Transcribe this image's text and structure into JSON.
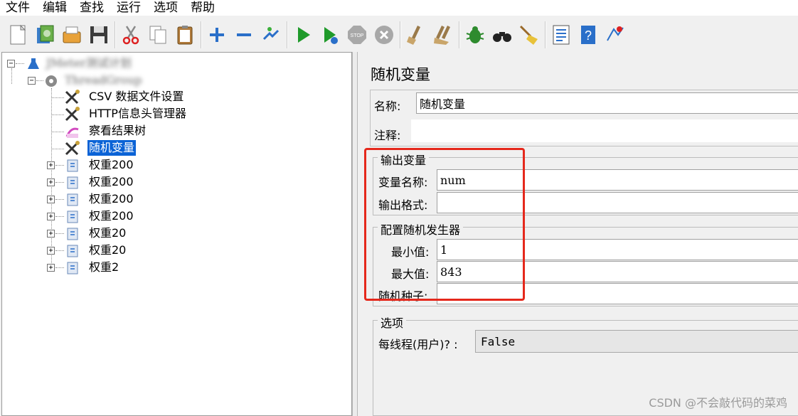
{
  "menu": [
    "文件",
    "编辑",
    "查找",
    "运行",
    "选项",
    "帮助"
  ],
  "toolbar": {
    "buttons": [
      "new-icon",
      "templates-icon",
      "open-icon",
      "save-icon",
      "cut-icon",
      "copy-icon",
      "paste-icon",
      "expand-icon",
      "collapse-icon",
      "toggle-icon",
      "start-icon",
      "start-no-pause-icon",
      "stop-icon",
      "shutdown-icon",
      "clear-icon",
      "clear-all-icon",
      "search-icon",
      "binoculars-icon",
      "broom-icon",
      "function-helper-icon",
      "help-icon",
      "remote-icon"
    ]
  },
  "tree": {
    "root_label": "JMeter测试计划",
    "thread_group_label": "ThreadGroup",
    "items": [
      {
        "label": "CSV 数据文件设置",
        "icon": "config-wrench-icon"
      },
      {
        "label": "HTTP信息头管理器",
        "icon": "config-wrench-icon"
      },
      {
        "label": "察看结果树",
        "icon": "listener-icon"
      },
      {
        "label": "随机变量",
        "icon": "config-wrench-icon",
        "selected": true
      },
      {
        "label": "权重200",
        "icon": "controller-icon"
      },
      {
        "label": "权重200",
        "icon": "controller-icon"
      },
      {
        "label": "权重200",
        "icon": "controller-icon"
      },
      {
        "label": "权重200",
        "icon": "controller-icon"
      },
      {
        "label": "权重20",
        "icon": "controller-icon"
      },
      {
        "label": "权重20",
        "icon": "controller-icon"
      },
      {
        "label": "权重2",
        "icon": "controller-icon"
      }
    ]
  },
  "panel": {
    "title": "随机变量",
    "name_label": "名称:",
    "name_value": "随机变量",
    "comment_label": "注释:",
    "comment_value": "",
    "output_group": "输出变量",
    "var_name_label": "变量名称:",
    "var_name_value": "num",
    "format_label": "输出格式:",
    "format_value": "",
    "random_group": "配置随机发生器",
    "min_label": "最小值:",
    "min_value": "1",
    "max_label": "最大值:",
    "max_value": "843",
    "seed_label": "随机种子:",
    "seed_value": "",
    "options_group": "选项",
    "per_thread_label": "每线程(用户)? :",
    "per_thread_value": "False"
  },
  "watermark": "CSDN @不会敲代码的菜鸡",
  "colors": {
    "selection": "#0b63d6",
    "highlight_box": "#e5281c"
  }
}
